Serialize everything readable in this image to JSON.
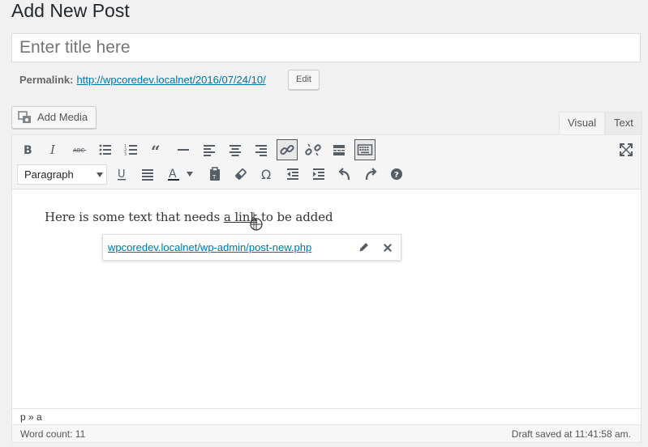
{
  "page": {
    "title": "Add New Post"
  },
  "post_title": {
    "value": "",
    "placeholder": "Enter title here"
  },
  "permalink": {
    "label": "Permalink:",
    "url": "http://wpcoredev.localnet/2016/07/24/10/",
    "edit_label": "Edit"
  },
  "media": {
    "add_label": "Add Media"
  },
  "tabs": {
    "visual": "Visual",
    "text": "Text"
  },
  "toolbar": {
    "format_value": "Paragraph"
  },
  "content": {
    "before": "Here is some text that needs ",
    "link": "a link",
    "after": " to be added"
  },
  "link_popup": {
    "url": "wpcoredev.localnet/wp-admin/post-new.php"
  },
  "status": {
    "path": "p » a",
    "word_count": "Word count: 11",
    "saved": "Draft saved at 11:41:58 am."
  },
  "colors": {
    "link": "#0073aa",
    "icon": "#555d66",
    "bg": "#f1f1f1"
  }
}
